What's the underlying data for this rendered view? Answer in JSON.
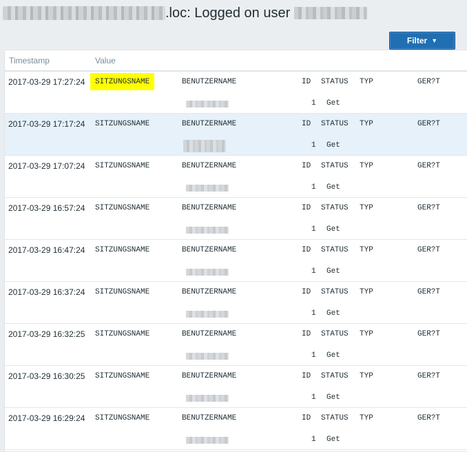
{
  "header": {
    "title": ".loc: Logged on user"
  },
  "toolbar": {
    "filter_label": "Filter",
    "filter_caret": "▼"
  },
  "table": {
    "columns": [
      "Timestamp",
      "Value"
    ],
    "value_headers": {
      "session": "SITZUNGSNAME",
      "user": "BENUTZERNAME",
      "id": "ID",
      "status": "STATUS",
      "typ": "TYP",
      "ger": "GER?T"
    },
    "value_row": {
      "id": "1",
      "status": "Get"
    },
    "highlight_color": "#ffff00",
    "selected_row_color": "#e6f1fa",
    "rows": [
      {
        "timestamp": "2017-03-29 17:27:24"
      },
      {
        "timestamp": "2017-03-29 17:17:24"
      },
      {
        "timestamp": "2017-03-29 17:07:24"
      },
      {
        "timestamp": "2017-03-29 16:57:24"
      },
      {
        "timestamp": "2017-03-29 16:47:24"
      },
      {
        "timestamp": "2017-03-29 16:37:24"
      },
      {
        "timestamp": "2017-03-29 16:32:25"
      },
      {
        "timestamp": "2017-03-29 16:30:25"
      },
      {
        "timestamp": "2017-03-29 16:29:24"
      }
    ]
  }
}
